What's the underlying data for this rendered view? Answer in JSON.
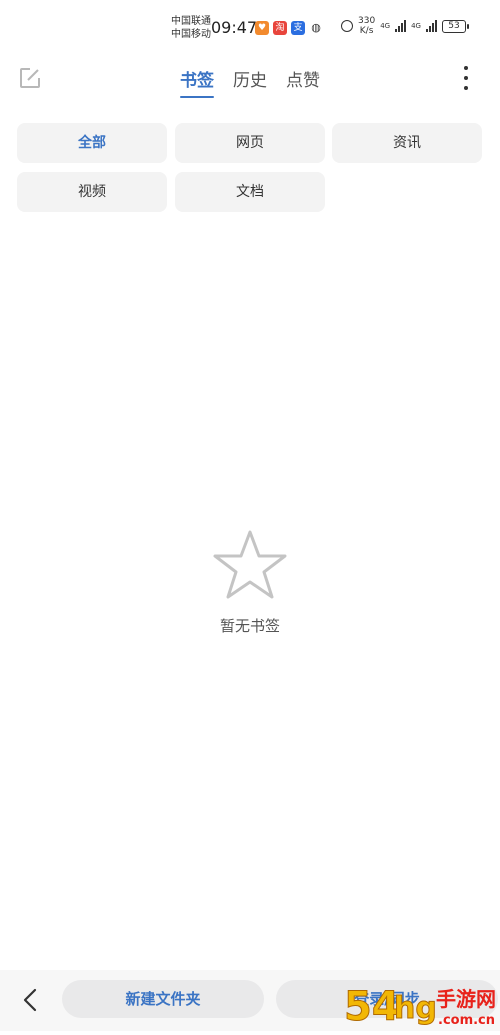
{
  "status_bar": {
    "carrier_1": "中国联通",
    "carrier_2": "中国移动",
    "time": "09:47",
    "net_speed_value": "330",
    "net_speed_unit": "K/s",
    "network_label_1": "4G",
    "network_label_2": "4G",
    "battery": "53"
  },
  "tabs": [
    {
      "label": "书签",
      "active": true
    },
    {
      "label": "历史",
      "active": false
    },
    {
      "label": "点赞",
      "active": false
    }
  ],
  "filters": [
    {
      "label": "全部",
      "active": true
    },
    {
      "label": "网页",
      "active": false
    },
    {
      "label": "资讯",
      "active": false
    },
    {
      "label": "视频",
      "active": false
    },
    {
      "label": "文档",
      "active": false
    }
  ],
  "empty_state": {
    "icon": "star-outline-icon",
    "text": "暂无书签"
  },
  "bottom_bar": {
    "new_folder_label": "新建文件夹",
    "login_label": "登录/同步"
  },
  "watermark": {
    "brand": "54hg手游网",
    "domain": ".com.cn"
  },
  "colors": {
    "accent": "#3b74c4",
    "pill_bg": "#f3f3f3",
    "text": "#333333"
  }
}
